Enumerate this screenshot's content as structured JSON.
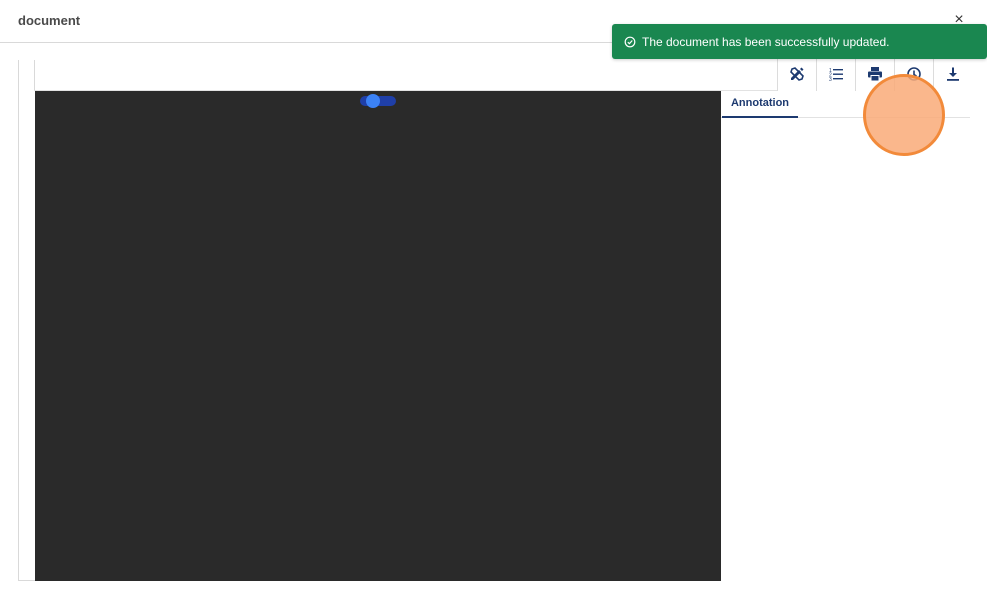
{
  "header": {
    "title": "document",
    "close_label": "×"
  },
  "toolbar": {
    "buttons": [
      {
        "name": "annotation-tools",
        "icon": "pencil-ruler-icon"
      },
      {
        "name": "outline",
        "icon": "list-ordered-icon"
      },
      {
        "name": "print",
        "icon": "print-icon"
      },
      {
        "name": "history",
        "icon": "history-clock-icon"
      },
      {
        "name": "download",
        "icon": "download-icon"
      }
    ]
  },
  "side_panel": {
    "tabs": [
      {
        "label": "Annotation",
        "active": true
      }
    ]
  },
  "toast": {
    "message": "The document has been successfully updated.",
    "icon": "check-circle-icon"
  },
  "colors": {
    "toast_bg": "#1a8750",
    "viewer_bg": "#2a2a2a",
    "tab_accent": "#1d3a70",
    "loader_dot": "#3b82f6",
    "cursor_highlight": "#f28a3a"
  }
}
